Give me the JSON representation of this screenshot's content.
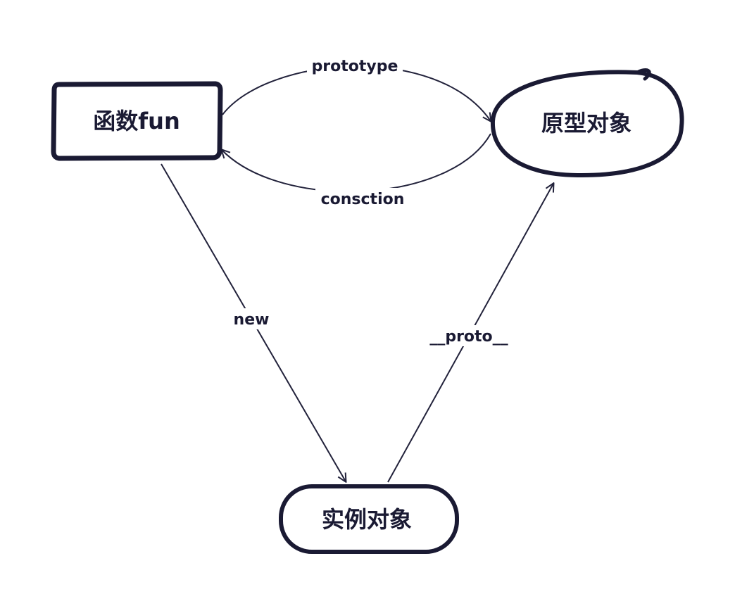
{
  "nodes": {
    "function": "函数fun",
    "prototype": "原型对象",
    "instance": "实例对象"
  },
  "edges": {
    "prototype": "prototype",
    "constructor": "consction",
    "new": "new",
    "proto": "__proto__"
  },
  "colors": {
    "ink": "#1a1a33",
    "line": "#22223b",
    "background": "#ffffff"
  }
}
